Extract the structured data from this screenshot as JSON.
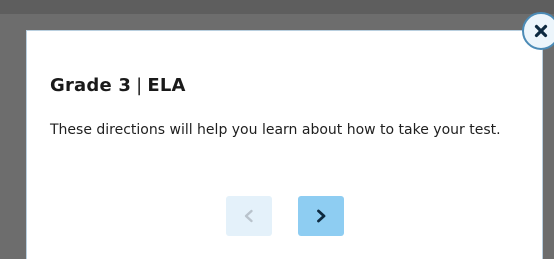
{
  "dialog": {
    "title_grade": "Grade 3",
    "title_separator": "|",
    "title_subject": "ELA",
    "body": "These directions will help you learn about how to take your test."
  },
  "buttons": {
    "prev": {
      "icon": "chevron-left-icon",
      "enabled": false
    },
    "next": {
      "icon": "chevron-right-icon",
      "enabled": true
    },
    "close": {
      "icon": "close-icon"
    }
  },
  "colors": {
    "accent": "#8ecdf2",
    "accent_disabled": "#e4f1fa",
    "close_border": "#4b8bb6",
    "icon_dark": "#0d2a40"
  }
}
